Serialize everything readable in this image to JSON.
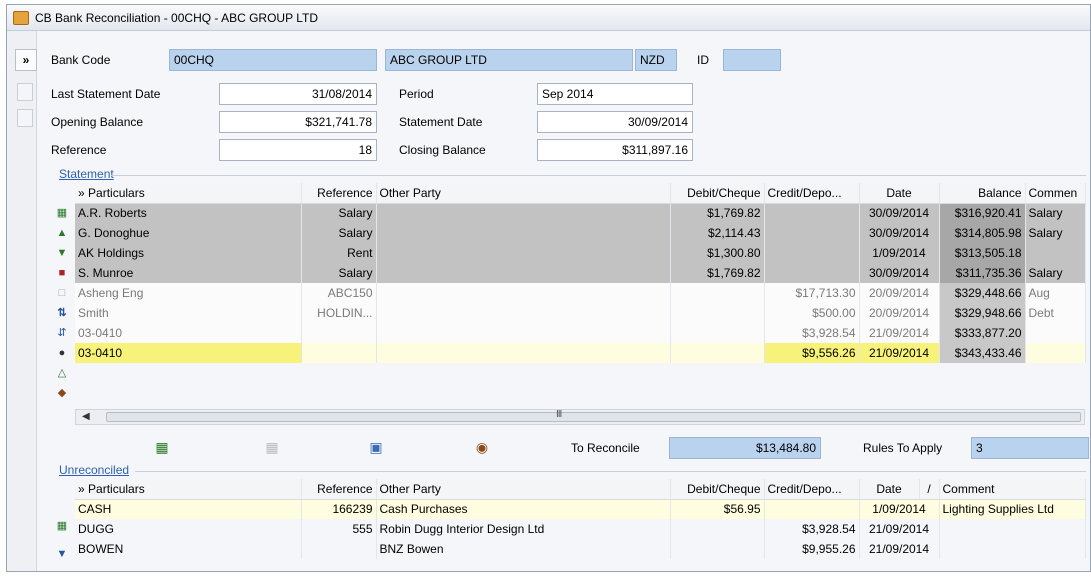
{
  "window": {
    "title": "CB Bank Reconciliation - 00CHQ - ABC GROUP LTD"
  },
  "header": {
    "expand_glyph": "»",
    "bank_code_label": "Bank Code",
    "bank_code": "00CHQ",
    "bank_name": "ABC GROUP LTD",
    "currency": "NZD",
    "id_label": "ID",
    "id_value": "",
    "last_statement_date_label": "Last Statement Date",
    "last_statement_date": "31/08/2014",
    "period_label": "Period",
    "period": "Sep 2014",
    "opening_balance_label": "Opening Balance",
    "opening_balance": "$321,741.78",
    "statement_date_label": "Statement Date",
    "statement_date": "30/09/2014",
    "reference_label": "Reference",
    "reference": "18",
    "closing_balance_label": "Closing Balance",
    "closing_balance": "$311,897.16"
  },
  "statement": {
    "title": "Statement",
    "expand_glyph": "»",
    "columns": [
      "Particulars",
      "Reference",
      "Other Party",
      "Debit/Cheque",
      "Credit/Depo...",
      "Date",
      "Balance",
      "Commen"
    ],
    "rows": [
      {
        "particulars": "A.R. Roberts",
        "reference": "Salary",
        "other_party": "",
        "debit": "$1,769.82",
        "credit": "",
        "date": "30/09/2014",
        "balance": "$316,920.41",
        "comment": "Salary"
      },
      {
        "particulars": "G. Donoghue",
        "reference": "Salary",
        "other_party": "",
        "debit": "$2,114.43",
        "credit": "",
        "date": "30/09/2014",
        "balance": "$314,805.98",
        "comment": "Salary"
      },
      {
        "particulars": "AK Holdings",
        "reference": "Rent",
        "other_party": "",
        "debit": "$1,300.80",
        "credit": "",
        "date": "1/09/2014",
        "balance": "$313,505.18",
        "comment": ""
      },
      {
        "particulars": "S. Munroe",
        "reference": "Salary",
        "other_party": "",
        "debit": "$1,769.82",
        "credit": "",
        "date": "30/09/2014",
        "balance": "$311,735.36",
        "comment": "Salary"
      },
      {
        "particulars": "Asheng Eng",
        "reference": "ABC150",
        "other_party": "",
        "debit": "",
        "credit": "$17,713.30",
        "date": "20/09/2014",
        "balance": "$329,448.66",
        "comment": "Aug"
      },
      {
        "particulars": "Smith",
        "reference": "HOLDIN...",
        "other_party": "",
        "debit": "",
        "credit": "$500.00",
        "date": "20/09/2014",
        "balance": "$329,948.66",
        "comment": "Debt"
      },
      {
        "particulars": "03-0410",
        "reference": "",
        "other_party": "",
        "debit": "",
        "credit": "$3,928.54",
        "date": "21/09/2014",
        "balance": "$333,877.20",
        "comment": ""
      },
      {
        "particulars": "03-0410",
        "reference": "",
        "other_party": "",
        "debit": "",
        "credit": "$9,556.26",
        "date": "21/09/2014",
        "balance": "$343,433.46",
        "comment": ""
      }
    ],
    "scroll_grip": "III"
  },
  "reconcile": {
    "to_reconcile_label": "To Reconcile",
    "to_reconcile": "$13,484.80",
    "rules_label": "Rules To Apply",
    "rules_value": "3"
  },
  "unreconciled": {
    "title": "Unreconciled",
    "expand_glyph": "»",
    "columns": [
      "Particulars",
      "Reference",
      "Other Party",
      "Debit/Cheque",
      "Credit/Depo...",
      "Date",
      "/",
      "Comment"
    ],
    "rows": [
      {
        "particulars": "CASH",
        "reference": "166239",
        "other_party": "Cash Purchases",
        "debit": "$56.95",
        "credit": "",
        "date": "1/09/2014",
        "comment": "Lighting Supplies Ltd"
      },
      {
        "particulars": "DUGG",
        "reference": "555",
        "other_party": "Robin Dugg Interior Design Ltd",
        "debit": "",
        "credit": "$3,928.54",
        "date": "21/09/2014",
        "comment": ""
      },
      {
        "particulars": "BOWEN",
        "reference": "",
        "other_party": "BNZ Bowen",
        "debit": "",
        "credit": "$9,955.26",
        "date": "21/09/2014",
        "comment": ""
      }
    ]
  },
  "colors": {
    "field_blue": "#b9d3ef",
    "highlight_yellow": "#f7f37a",
    "link_blue": "#2d5fb2"
  }
}
